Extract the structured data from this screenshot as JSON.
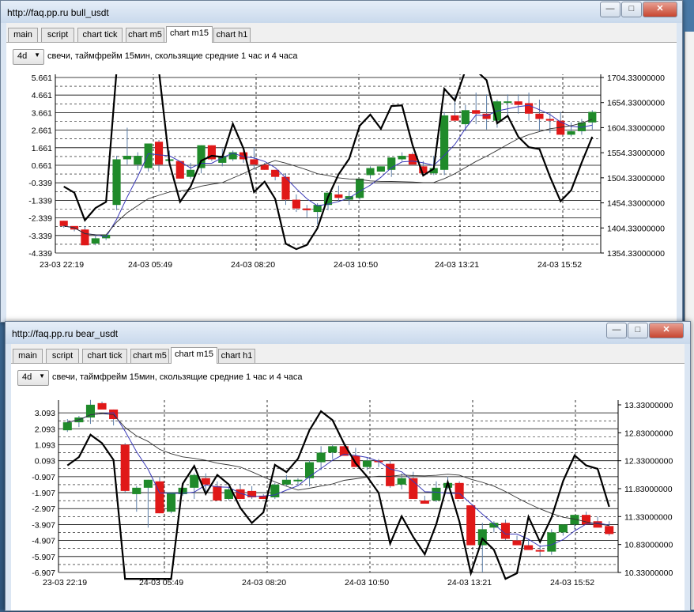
{
  "windows": [
    {
      "title": "http://faq.pp.ru bull_usdt",
      "tabs": [
        "main",
        "script",
        "chart tick",
        "chart m5",
        "chart m15",
        "chart h1"
      ],
      "active_tab": "chart m15",
      "timeframe": "4d",
      "description": "свечи, таймфрейм 15мин, скользящие средние 1 час и 4 часа"
    },
    {
      "title": "http://faq.pp.ru bear_usdt",
      "tabs": [
        "main",
        "script",
        "chart tick",
        "chart m5",
        "chart m15",
        "chart h1"
      ],
      "active_tab": "chart m15",
      "timeframe": "4d",
      "description": "свечи, таймфрейм 15мин, скользящие средние 1 час и 4 часа"
    }
  ],
  "colors": {
    "bull": "#1f8a2a",
    "bear": "#e01818",
    "ma_fast": "#3a3ab8",
    "ma_slow": "#000000",
    "overlay": "#000000"
  },
  "chart_data": [
    {
      "type": "candlestick",
      "series_count_visible": 3,
      "x_tick_labels": [
        "23-03 22:19",
        "24-03 05:49",
        "24-03 08:20",
        "24-03 10:50",
        "24-03 13:21",
        "24-03 15:52"
      ],
      "y_left_ticks": [
        "5.661",
        "4.661",
        "3.661",
        "2.661",
        "1.661",
        "0.661",
        "-0.339",
        "-1.339",
        "-2.339",
        "-3.339",
        "-4.339"
      ],
      "y_right_ticks": [
        "1704.33000000",
        "1654.33000000",
        "1604.33000000",
        "1554.33000000",
        "1504.33000000",
        "1454.33000000",
        "1404.33000000",
        "1354.33000000"
      ],
      "y_left_range": [
        -4.339,
        5.661
      ],
      "grid": true,
      "candles": [
        [
          -2.5,
          -2.5,
          -2.9,
          -2.8
        ],
        [
          -2.8,
          -2.9,
          -3.1,
          -3.0
        ],
        [
          -3.0,
          -2.8,
          -3.9,
          -3.9
        ],
        [
          -3.8,
          -3.3,
          -3.9,
          -3.5
        ],
        [
          -3.5,
          -3.3,
          -3.6,
          -3.3
        ],
        [
          -1.6,
          1.2,
          -1.9,
          1.0
        ],
        [
          1.0,
          2.8,
          0.7,
          1.2
        ],
        [
          0.7,
          1.4,
          0.4,
          1.2
        ],
        [
          0.5,
          1.7,
          0.3,
          1.9
        ],
        [
          2.0,
          2.1,
          0.3,
          0.7
        ],
        [
          1.0,
          1.5,
          0.7,
          1.0
        ],
        [
          0.9,
          0.9,
          -0.1,
          -0.1
        ],
        [
          0.0,
          0.8,
          -0.1,
          0.4
        ],
        [
          0.5,
          1.8,
          0.2,
          1.8
        ],
        [
          1.8,
          1.8,
          0.9,
          1.0
        ],
        [
          0.8,
          1.6,
          0.6,
          1.2
        ],
        [
          1.0,
          1.5,
          0.9,
          1.4
        ],
        [
          1.4,
          1.6,
          0.8,
          1.0
        ],
        [
          1.0,
          1.7,
          0.4,
          0.7
        ],
        [
          0.7,
          0.8,
          0.4,
          0.4
        ],
        [
          0.4,
          0.4,
          -0.2,
          0.0
        ],
        [
          0.0,
          0.2,
          -1.6,
          -1.3
        ],
        [
          -1.3,
          -1.0,
          -2.0,
          -1.8
        ],
        [
          -1.8,
          -1.6,
          -2.3,
          -1.9
        ],
        [
          -2.0,
          -1.5,
          -2.7,
          -1.6
        ],
        [
          -1.6,
          -0.9,
          -1.9,
          -0.9
        ],
        [
          -1.0,
          -0.5,
          -1.4,
          -1.2
        ],
        [
          -1.3,
          -0.8,
          -1.6,
          -1.1
        ],
        [
          -1.2,
          -0.1,
          -1.3,
          -0.1
        ],
        [
          0.1,
          0.6,
          -0.1,
          0.5
        ],
        [
          0.3,
          0.6,
          0.3,
          0.6
        ],
        [
          0.4,
          1.1,
          0.0,
          1.1
        ],
        [
          1.0,
          1.4,
          0.9,
          1.2
        ],
        [
          1.3,
          1.4,
          0.8,
          0.7
        ],
        [
          0.6,
          0.9,
          0.1,
          0.2
        ],
        [
          0.2,
          1.2,
          0.1,
          0.5
        ],
        [
          0.4,
          3.7,
          0.1,
          3.5
        ],
        [
          3.5,
          4.6,
          3.3,
          3.2
        ],
        [
          3.0,
          4.1,
          2.6,
          3.8
        ],
        [
          3.8,
          4.8,
          3.0,
          3.6
        ],
        [
          3.6,
          4.7,
          2.7,
          3.3
        ],
        [
          3.2,
          4.4,
          2.8,
          4.3
        ],
        [
          4.3,
          4.7,
          3.5,
          4.3
        ],
        [
          4.3,
          4.7,
          3.6,
          4.1
        ],
        [
          4.2,
          4.8,
          3.2,
          3.6
        ],
        [
          3.6,
          4.4,
          2.6,
          3.3
        ],
        [
          3.3,
          3.7,
          2.5,
          3.2
        ],
        [
          3.2,
          3.7,
          2.4,
          2.4
        ],
        [
          2.4,
          3.1,
          2.3,
          2.6
        ],
        [
          2.6,
          3.3,
          2.4,
          3.1
        ],
        [
          3.1,
          3.8,
          2.7,
          3.7
        ]
      ]
    },
    {
      "type": "candlestick",
      "series_count_visible": 3,
      "x_tick_labels": [
        "23-03 22:19",
        "24-03 05:49",
        "24-03 08:20",
        "24-03 10:50",
        "24-03 13:21",
        "24-03 15:52"
      ],
      "y_left_ticks": [
        "3.093",
        "2.093",
        "1.093",
        "0.093",
        "-0.907",
        "-1.907",
        "-2.907",
        "-3.907",
        "-4.907",
        "-5.907",
        "-6.907"
      ],
      "y_right_ticks": [
        "13.33000000",
        "12.83000000",
        "12.33000000",
        "11.83000000",
        "11.33000000",
        "10.83000000",
        "10.33000000"
      ],
      "y_left_range": [
        -6.907,
        3.593
      ],
      "grid": true,
      "candles": [
        [
          2.0,
          2.7,
          1.9,
          2.5
        ],
        [
          2.5,
          2.9,
          2.2,
          2.8
        ],
        [
          2.8,
          3.9,
          2.4,
          3.6
        ],
        [
          3.7,
          3.8,
          3.4,
          3.3
        ],
        [
          3.3,
          3.3,
          2.3,
          2.7
        ],
        [
          1.1,
          1.2,
          -1.9,
          -1.8
        ],
        [
          -2.0,
          -1.5,
          -3.1,
          -1.6
        ],
        [
          -1.6,
          -1.1,
          -4.1,
          -1.1
        ],
        [
          -1.2,
          -0.9,
          -3.2,
          -3.2
        ],
        [
          -3.1,
          -1.9,
          -3.2,
          -1.9
        ],
        [
          -2.0,
          -1.8,
          -2.1,
          -1.6
        ],
        [
          -1.6,
          -0.7,
          -2.3,
          -0.8
        ],
        [
          -1.0,
          -0.7,
          -2.0,
          -1.4
        ],
        [
          -1.5,
          -1.2,
          -2.4,
          -2.4
        ],
        [
          -2.3,
          -1.6,
          -2.4,
          -1.7
        ],
        [
          -1.7,
          -1.4,
          -2.1,
          -2.3
        ],
        [
          -1.8,
          -1.5,
          -2.3,
          -2.2
        ],
        [
          -2.1,
          -2.0,
          -2.3,
          -2.3
        ],
        [
          -2.2,
          -1.3,
          -2.3,
          -1.4
        ],
        [
          -1.4,
          -0.8,
          -1.5,
          -1.1
        ],
        [
          -1.1,
          -1.0,
          -1.4,
          -1.1
        ],
        [
          -1.0,
          0.1,
          -1.5,
          0.0
        ],
        [
          0.0,
          1.0,
          -0.5,
          0.6
        ],
        [
          0.6,
          1.1,
          0.2,
          1.0
        ],
        [
          1.0,
          1.2,
          0.4,
          0.4
        ],
        [
          0.4,
          0.9,
          0.2,
          -0.3
        ],
        [
          -0.3,
          0.3,
          -0.5,
          0.1
        ],
        [
          0.1,
          0.2,
          -0.3,
          0.0
        ],
        [
          -0.1,
          0.1,
          -1.6,
          -1.5
        ],
        [
          -1.4,
          -0.7,
          -1.7,
          -1.0
        ],
        [
          -1.0,
          -0.6,
          -2.0,
          -2.3
        ],
        [
          -2.4,
          -2.1,
          -2.5,
          -2.6
        ],
        [
          -2.4,
          -1.2,
          -2.5,
          -1.6
        ],
        [
          -1.6,
          -0.9,
          -1.7,
          -1.3
        ],
        [
          -1.3,
          -1.2,
          -1.8,
          -2.3
        ],
        [
          -2.7,
          -2.8,
          -5.2,
          -5.2
        ],
        [
          -5.2,
          -3.8,
          -6.9,
          -4.2
        ],
        [
          -4.1,
          -3.7,
          -4.4,
          -3.8
        ],
        [
          -3.8,
          -3.6,
          -4.9,
          -4.8
        ],
        [
          -4.9,
          -4.6,
          -5.2,
          -5.2
        ],
        [
          -5.2,
          -4.8,
          -5.4,
          -5.5
        ],
        [
          -5.5,
          -5.2,
          -5.9,
          -5.6
        ],
        [
          -5.6,
          -4.2,
          -5.8,
          -4.4
        ],
        [
          -4.4,
          -3.9,
          -4.6,
          -3.9
        ],
        [
          -3.9,
          -3.5,
          -4.2,
          -3.3
        ],
        [
          -3.3,
          -3.1,
          -3.8,
          -3.9
        ],
        [
          -3.7,
          -3.4,
          -4.0,
          -4.1
        ],
        [
          -4.0,
          -3.7,
          -4.6,
          -4.5
        ]
      ]
    }
  ]
}
